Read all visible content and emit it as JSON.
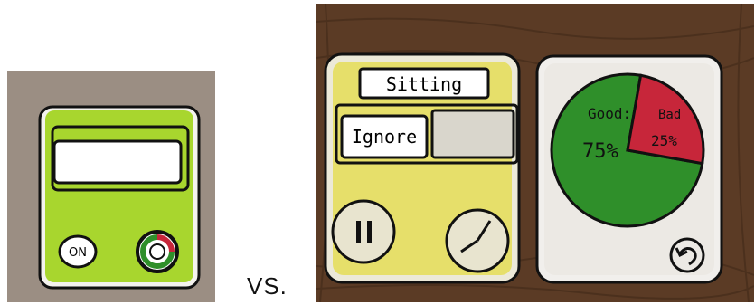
{
  "separator_text": "VS.",
  "prototype_a": {
    "on_button_label": "ON",
    "colors": {
      "screen": "#a8d62e",
      "backdrop": "#9a8c80"
    }
  },
  "prototype_b": {
    "mode_label": "Sitting",
    "ignore_button_label": "Ignore",
    "pause_icon": "pause-icon",
    "timer_icon": "timer-icon",
    "chart_good_label": "Good:",
    "chart_good_value": "75%",
    "chart_bad_label": "Bad",
    "chart_bad_value": "25%",
    "back_icon": "back-arrow-icon",
    "colors": {
      "screen": "#e6df6a",
      "good": "#2f8f2a",
      "bad": "#c7263a",
      "wood": "#5b3b25"
    }
  },
  "chart_data": {
    "type": "pie",
    "categories": [
      "Good",
      "Bad"
    ],
    "values": [
      75,
      25
    ]
  }
}
